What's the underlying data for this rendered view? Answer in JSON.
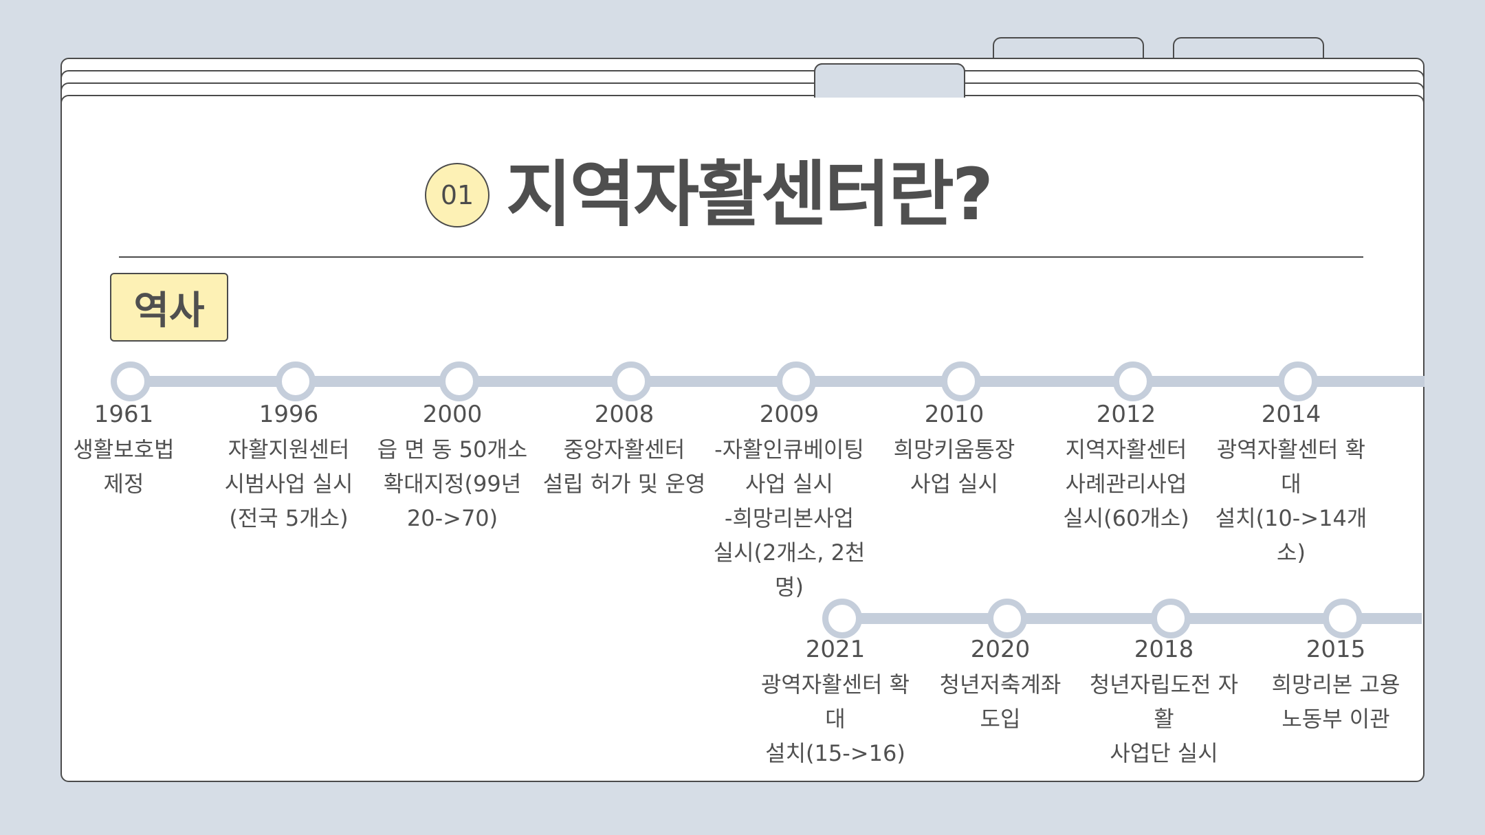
{
  "header": {
    "badge": "01",
    "title": "지역자활센터란?"
  },
  "section": {
    "label": "역사"
  },
  "timeline": {
    "row1": [
      {
        "year": "1961",
        "lines": [
          "생활보호법",
          "제정"
        ]
      },
      {
        "year": "1996",
        "lines": [
          "자활지원센터",
          "시범사업 실시",
          "(전국 5개소)"
        ]
      },
      {
        "year": "2000",
        "lines": [
          "읍 면 동 50개소",
          "확대지정(99년",
          "20->70)"
        ]
      },
      {
        "year": "2008",
        "lines": [
          "중앙자활센터",
          "설립 허가 및 운영"
        ]
      },
      {
        "year": "2009",
        "lines": [
          "-자활인큐베이팅",
          "사업 실시",
          "-희망리본사업",
          "실시(2개소, 2천 명)"
        ]
      },
      {
        "year": "2010",
        "lines": [
          "희망키움통장",
          "사업 실시"
        ]
      },
      {
        "year": "2012",
        "lines": [
          "지역자활센터",
          "사례관리사업",
          "실시(60개소)"
        ]
      },
      {
        "year": "2014",
        "lines": [
          "광역자활센터 확대",
          "설치(10->14개소)"
        ]
      }
    ],
    "row2": [
      {
        "year": "2021",
        "lines": [
          "광역자활센터 확대",
          "설치(15->16)"
        ]
      },
      {
        "year": "2020",
        "lines": [
          "청년저축계좌",
          "도입"
        ]
      },
      {
        "year": "2018",
        "lines": [
          "청년자립도전 자활",
          "사업단 실시"
        ]
      },
      {
        "year": "2015",
        "lines": [
          "희망리본 고용",
          "노동부 이관"
        ]
      }
    ]
  },
  "colors": {
    "background": "#d6dde6",
    "badge_fill": "#fdf1b5",
    "timeline_line": "#c5cedb",
    "text": "#4f4f4f"
  }
}
